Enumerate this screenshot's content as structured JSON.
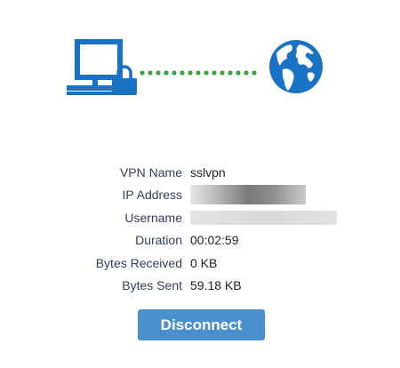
{
  "colors": {
    "icon_blue": "#1a72c4",
    "dots_green": "#38a538",
    "button_bg": "#4a90cf",
    "label_text": "#33405a"
  },
  "icons": {
    "computer": "computer-icon",
    "lock": "lock-icon",
    "globe": "globe-icon",
    "connection": "connection-dots"
  },
  "info": {
    "rows": [
      {
        "label": "VPN Name",
        "value": "sslvpn"
      },
      {
        "label": "IP Address",
        "value": ""
      },
      {
        "label": "Username",
        "value": ""
      },
      {
        "label": "Duration",
        "value": "00:02:59"
      },
      {
        "label": "Bytes Received",
        "value": "0 KB"
      },
      {
        "label": "Bytes Sent",
        "value": "59.18 KB"
      }
    ]
  },
  "actions": {
    "disconnect_label": "Disconnect"
  }
}
